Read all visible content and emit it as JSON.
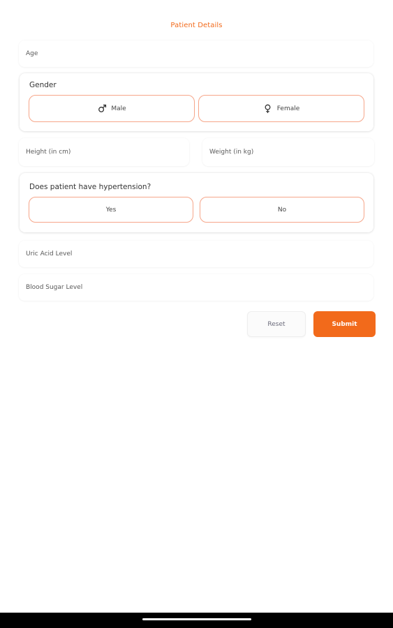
{
  "form": {
    "title": "Patient Details",
    "age": {
      "placeholder": "Age"
    },
    "gender": {
      "label": "Gender",
      "options": [
        {
          "label": "Male",
          "icon": "male-symbol-icon"
        },
        {
          "label": "Female",
          "icon": "female-symbol-icon"
        }
      ]
    },
    "height": {
      "placeholder": "Height (in cm)"
    },
    "weight": {
      "placeholder": "Weight (in kg)"
    },
    "hypertension": {
      "label": "Does patient have hypertension?",
      "options": [
        {
          "label": "Yes"
        },
        {
          "label": "No"
        }
      ]
    },
    "uric_acid": {
      "placeholder": "Uric Acid Level"
    },
    "blood_sugar": {
      "placeholder": "Blood Sugar Level"
    }
  },
  "actions": {
    "reset_label": "Reset",
    "submit_label": "Submit"
  },
  "colors": {
    "accent": "#f26a1b",
    "option_border": "#f6a68a",
    "background": "#ffffff"
  }
}
